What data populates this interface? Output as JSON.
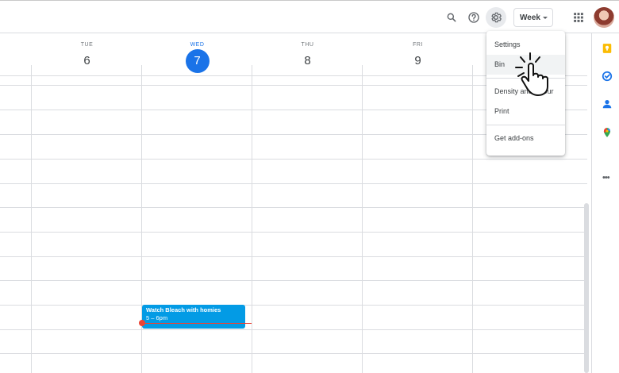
{
  "toolbar": {
    "view_select": "Week",
    "icons": [
      "search-icon",
      "help-icon",
      "settings-gear-icon",
      "apps-grid-icon",
      "avatar"
    ]
  },
  "days": [
    {
      "dow": "TUE",
      "num": "6",
      "today": false
    },
    {
      "dow": "WED",
      "num": "7",
      "today": true
    },
    {
      "dow": "THU",
      "num": "8",
      "today": false
    },
    {
      "dow": "FRI",
      "num": "9",
      "today": false
    }
  ],
  "event": {
    "title": "Watch Bleach with homies",
    "time": "5 – 6pm",
    "color": "#039be5"
  },
  "settings_menu": {
    "items": [
      "Settings",
      "Bin",
      "Density and colour",
      "Print",
      "Get add-ons"
    ],
    "hovered": "Bin"
  },
  "side_panel": {
    "icons": [
      "keep-icon",
      "tasks-icon",
      "contacts-icon",
      "maps-icon",
      "more-icon"
    ]
  },
  "colors": {
    "accent": "#1a73e8",
    "now_line": "#ea4335"
  }
}
